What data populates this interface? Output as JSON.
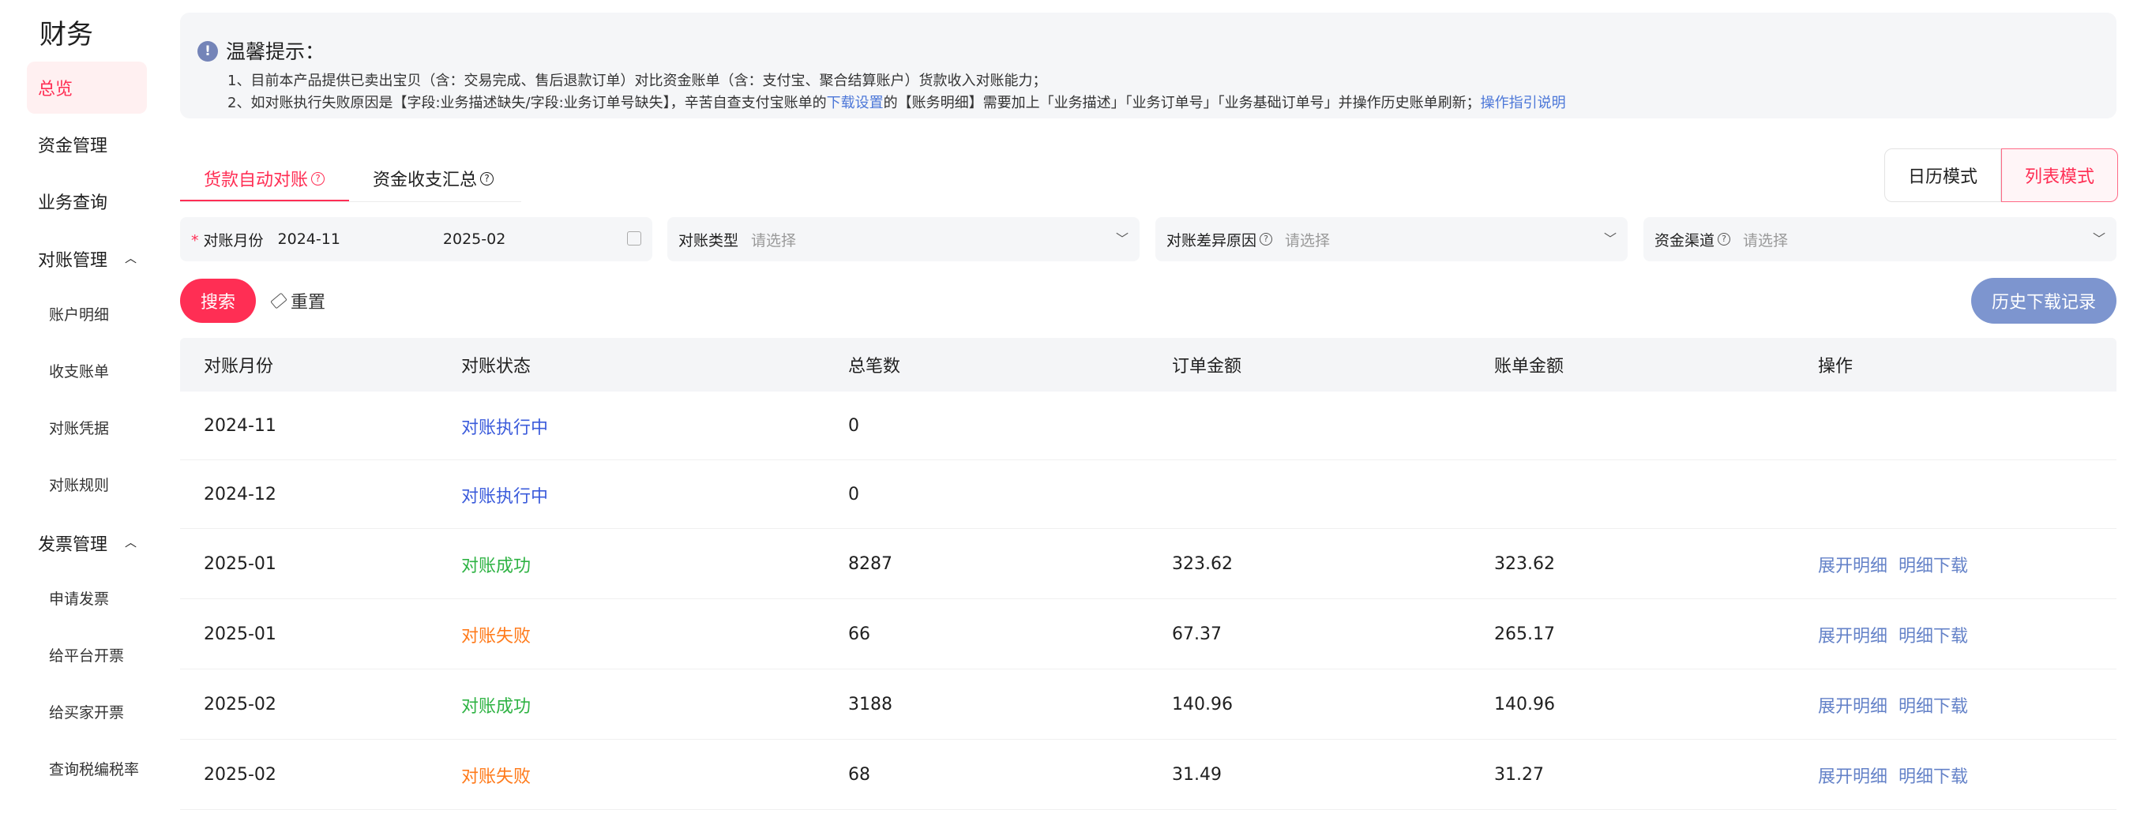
{
  "sidebar": {
    "title": "财务",
    "overview": "总览",
    "fund_mgmt": "资金管理",
    "biz_query": "业务查询",
    "recon_group": "对账管理",
    "recon_items": [
      "账户明细",
      "收支账单",
      "对账凭据",
      "对账规则"
    ],
    "invoice_group": "发票管理",
    "invoice_items": [
      "申请发票",
      "给平台开票",
      "给买家开票",
      "查询税编税率"
    ]
  },
  "notice": {
    "title": "温馨提示：",
    "line1": "1、目前本产品提供已卖出宝贝（含：交易完成、售后退款订单）对比资金账单（含：支付宝、聚合结算账户）货款收入对账能力；",
    "line2_a": "2、如对账执行失败原因是【字段:业务描述缺失/字段:业务订单号缺失】，辛苦自查支付宝账单的",
    "line2_link": "下载设置",
    "line2_b": "的【账务明细】需要加上「业务描述」「业务订单号」「业务基础订单号」并操作历史账单刷新；",
    "line2_link2": "操作指引说明"
  },
  "tabs": {
    "auto_recon": "货款自动对账",
    "fund_summary": "资金收支汇总"
  },
  "mode": {
    "calendar": "日历模式",
    "list": "列表模式"
  },
  "filters": {
    "month_label": "对账月份",
    "month_start": "2024-11",
    "month_end": "2025-02",
    "type_label": "对账类型",
    "diff_label": "对账差异原因",
    "channel_label": "资金渠道",
    "placeholder": "请选择"
  },
  "actions": {
    "search": "搜索",
    "reset": "重置",
    "history": "历史下载记录"
  },
  "table": {
    "headers": [
      "对账月份",
      "对账状态",
      "总笔数",
      "订单金额",
      "账单金额",
      "操作"
    ],
    "op_expand": "展开明细",
    "op_download": "明细下载",
    "rows": [
      {
        "month": "2024-11",
        "status": "对账执行中",
        "count": "0",
        "order_amt": "",
        "bill_amt": "",
        "ops": false,
        "kind": "run"
      },
      {
        "month": "2024-12",
        "status": "对账执行中",
        "count": "0",
        "order_amt": "",
        "bill_amt": "",
        "ops": false,
        "kind": "run"
      },
      {
        "month": "2025-01",
        "status": "对账成功",
        "count": "8287",
        "order_amt": "323.62",
        "bill_amt": "323.62",
        "ops": true,
        "kind": "ok"
      },
      {
        "month": "2025-01",
        "status": "对账失败",
        "count": "66",
        "order_amt": "67.37",
        "bill_amt": "265.17",
        "ops": true,
        "kind": "fail"
      },
      {
        "month": "2025-02",
        "status": "对账成功",
        "count": "3188",
        "order_amt": "140.96",
        "bill_amt": "140.96",
        "ops": true,
        "kind": "ok"
      },
      {
        "month": "2025-02",
        "status": "对账失败",
        "count": "68",
        "order_amt": "31.49",
        "bill_amt": "31.27",
        "ops": true,
        "kind": "fail"
      }
    ]
  },
  "colors": {
    "accent": "#ff2e54",
    "running": "#3b5bdb",
    "success": "#2fb344",
    "failed": "#ff7a1a",
    "link": "#6482c8"
  }
}
